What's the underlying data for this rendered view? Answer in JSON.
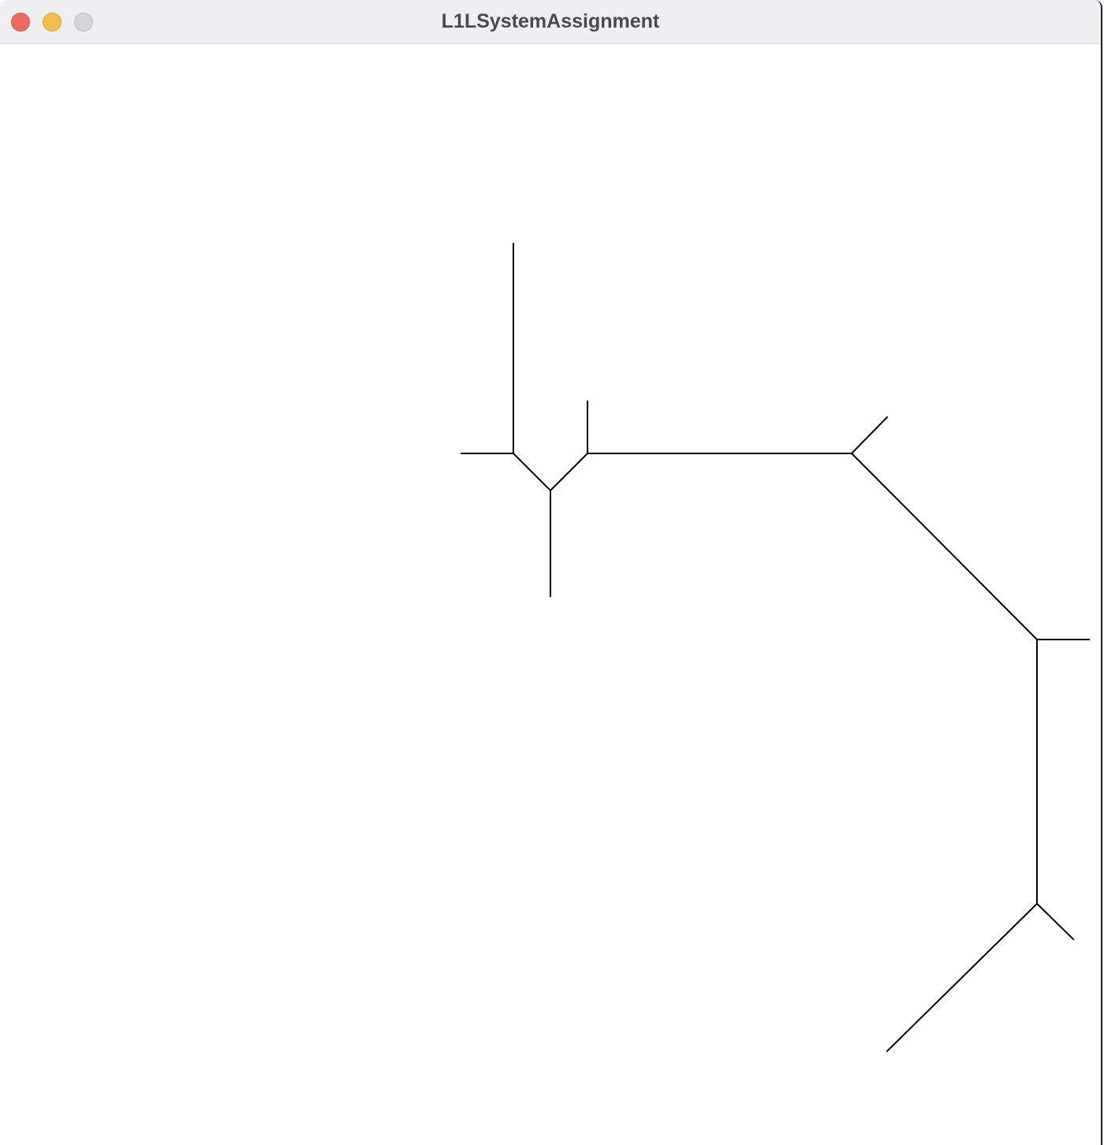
{
  "window": {
    "title": "L1LSystemAssignment",
    "controls": {
      "close_color": "#ee6a5f",
      "minimize_color": "#f5bd4f",
      "zoom_color": "#d5d5d7"
    }
  },
  "drawing": {
    "stroke_color": "#000000",
    "background_color": "#ffffff"
  }
}
